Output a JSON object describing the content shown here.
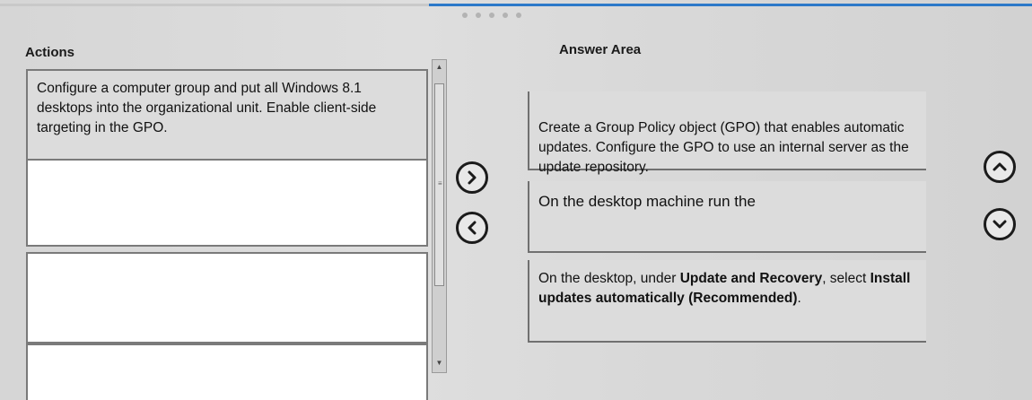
{
  "actions": {
    "heading": "Actions",
    "items": [
      {
        "text": "Configure a computer group and put all Windows 8.1 desktops into the organizational unit. Enable client-side targeting in the GPO."
      },
      {
        "text": ""
      },
      {
        "text": ""
      },
      {
        "text": ""
      }
    ]
  },
  "answer_area": {
    "heading": "Answer Area",
    "items": [
      {
        "text": "Create a Group Policy object (GPO) that enables automatic updates. Configure the GPO to use an internal server as the update repository."
      },
      {
        "text": "On the desktop machine run the"
      },
      {
        "parts": [
          "On the desktop, under ",
          "Update and Recovery",
          ", select ",
          "Install updates automatically (Recommended)",
          "."
        ]
      }
    ]
  },
  "controls": {
    "move_right_icon": "chevron-right",
    "move_left_icon": "chevron-left",
    "move_up_icon": "chevron-up",
    "move_down_icon": "chevron-down"
  },
  "colors": {
    "accent_blue": "#2c79c9",
    "item_gray": "#dcdcdc",
    "empty_item": "#ffffff"
  }
}
